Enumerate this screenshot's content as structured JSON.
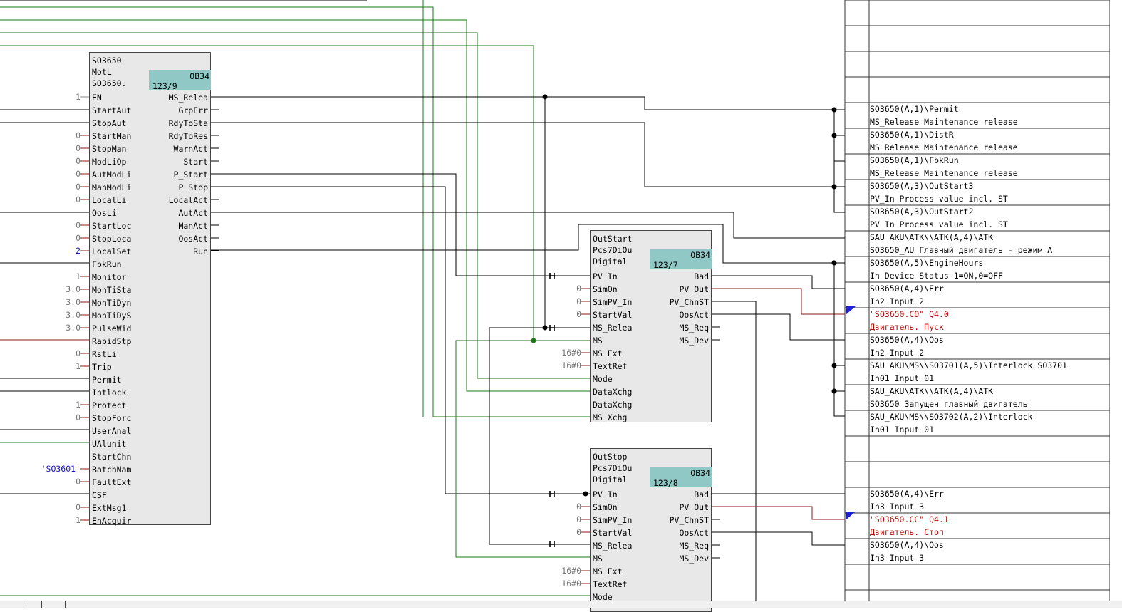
{
  "block_mot": {
    "header": [
      "SO3650",
      "MotL",
      "SO3650."
    ],
    "ob": "OB34",
    "ob_sub": "123/9",
    "inputs": [
      "EN",
      "StartAut",
      "StopAut",
      "StartMan",
      "StopMan",
      "ModLiOp",
      "AutModLi",
      "ManModLi",
      "LocalLi",
      "OosLi",
      "StartLoc",
      "StopLoca",
      "LocalSet",
      "FbkRun",
      "Monitor",
      "MonTiSta",
      "MonTiDyn",
      "MonTiDyS",
      "PulseWid",
      "RapidStp",
      "RstLi",
      "Trip",
      "Permit",
      "Intlock",
      "Protect",
      "StopForc",
      "UserAnal",
      "UAlunit",
      "StartChn",
      "BatchNam",
      "FaultExt",
      "CSF",
      "ExtMsg1",
      "EnAcquir"
    ],
    "input_values": [
      "1",
      "",
      "",
      "0",
      "0",
      "0",
      "0",
      "0",
      "0",
      "",
      "0",
      "0",
      "2",
      "",
      "1",
      "3.0",
      "3.0",
      "3.0",
      "3.0",
      "",
      "0",
      "1",
      "",
      "",
      "1",
      "0",
      "",
      "",
      "",
      "'SO3601'",
      "0",
      "",
      "0",
      "1"
    ],
    "outputs": [
      "MS_Relea",
      "GrpErr",
      "RdyToSta",
      "RdyToRes",
      "WarnAct",
      "Start",
      "P_Start",
      "P_Stop",
      "LocalAct",
      "AutAct",
      "ManAct",
      "OosAct",
      "Run"
    ]
  },
  "block_start": {
    "header": [
      "OutStart",
      "Pcs7DiOu",
      "Digital"
    ],
    "ob": "OB34",
    "ob_sub": "123/7",
    "inputs": [
      "PV_In",
      "SimOn",
      "SimPV_In",
      "StartVal",
      "MS_Relea",
      "MS",
      "MS_Ext",
      "TextRef",
      "Mode",
      "DataXchg",
      "DataXchg",
      "MS_Xchg"
    ],
    "input_values": [
      "",
      "0",
      "0",
      "0",
      "",
      "",
      "16#0",
      "16#0",
      "",
      "",
      "",
      ""
    ],
    "outputs": [
      "Bad",
      "PV_Out",
      "PV_ChnST",
      "OosAct",
      "MS_Req",
      "MS_Dev"
    ]
  },
  "block_stop": {
    "header": [
      "OutStop",
      "Pcs7DiOu",
      "Digital"
    ],
    "ob": "OB34",
    "ob_sub": "123/8",
    "inputs": [
      "PV_In",
      "SimOn",
      "SimPV_In",
      "StartVal",
      "MS_Relea",
      "MS",
      "MS_Ext",
      "TextRef",
      "Mode"
    ],
    "input_values": [
      "",
      "0",
      "0",
      "0",
      "",
      "",
      "16#0",
      "16#0",
      ""
    ],
    "outputs": [
      "Bad",
      "PV_Out",
      "PV_ChnST",
      "OosAct",
      "MS_Req",
      "MS_Dev"
    ]
  },
  "sheet_refs": [
    {
      "line1": "SO3650(A,1)\\Permit",
      "line2": "MS_Release Maintenance release"
    },
    {
      "line1": "SO3650(A,1)\\DistR",
      "line2": "MS_Release Maintenance release"
    },
    {
      "line1": "SO3650(A,1)\\FbkRun",
      "line2": "MS_Release Maintenance release"
    },
    {
      "line1": "SO3650(A,3)\\OutStart3",
      "line2": "PV_In Process value incl. ST"
    },
    {
      "line1": "SO3650(A,3)\\OutStart2",
      "line2": "PV_In Process value incl. ST"
    },
    {
      "line1": "SAU_AKU\\ATK\\\\ATK(A,4)\\ATK",
      "line2": "SO3650_AU Главный двигатель - режим А"
    },
    {
      "line1": "SO3650(A,5)\\EngineHours",
      "line2": "In Device Status 1=ON,0=OFF"
    },
    {
      "line1": "SO3650(A,4)\\Err",
      "line2": "In2 Input 2"
    },
    {
      "line1": "\"SO3650.CO\" Q4.0",
      "line2": "Двигатель. Пуск",
      "io": true
    },
    {
      "line1": "SO3650(A,4)\\Oos",
      "line2": "In2 Input 2"
    },
    {
      "line1": "SAU_AKU\\MS\\\\SO3701(A,5)\\Interlock_SO3701",
      "line2": "In01 Input 01"
    },
    {
      "line1": "SAU_AKU\\ATK\\\\ATK(A,4)\\ATK",
      "line2": "SO3650 Запущен главный двигатель"
    },
    {
      "line1": "SAU_AKU\\MS\\\\SO3702(A,2)\\Interlock",
      "line2": "In01 Input 01"
    },
    {
      "line1": "SO3650(A,4)\\Err",
      "line2": "In3 Input 3"
    },
    {
      "line1": "\"SO3650.CC\" Q4.1",
      "line2": "Двигатель. Стоп",
      "io": true
    },
    {
      "line1": "SO3650(A,4)\\Oos",
      "line2": "In3 Input 3"
    }
  ],
  "colors": {
    "wire": "#000000",
    "wire_green": "#1a7a1a",
    "wire_red": "#8b1a1a",
    "ob_fill": "#8fc8c4",
    "block_fill": "#e8e8e8",
    "io_marker": "#2020d0"
  }
}
